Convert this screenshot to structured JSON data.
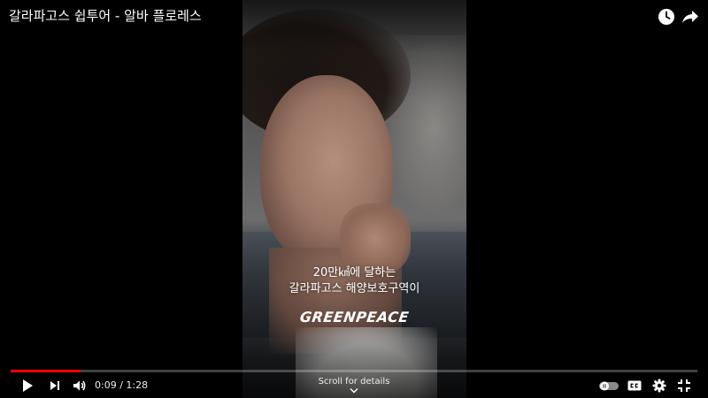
{
  "video": {
    "title": "갈라파고스 쉽투어 - 알바 플로레스",
    "caption_line1": "20만㎢에 달하는",
    "caption_line2": "갈라파고스 해양보호구역이",
    "logo_text": "GREENPEACE"
  },
  "top_actions": [
    {
      "name": "watch-later",
      "icon": "clock-icon"
    },
    {
      "name": "share",
      "icon": "share-arrow-icon"
    }
  ],
  "controls": {
    "current_time": "0:09",
    "duration": "1:28",
    "time_display": "0:09 / 1:28",
    "progress_fraction": 0.102,
    "scroll_hint": "Scroll for details",
    "play_icon": "play-icon",
    "next_icon": "next-icon",
    "volume_icon": "volume-icon",
    "autoplay_icon": "autoplay-toggle-icon",
    "cc_icon": "cc-icon",
    "settings_icon": "gear-icon",
    "fullscreen_icon": "exit-fullscreen-icon"
  },
  "colors": {
    "progress": "#ff0000",
    "background": "#000000"
  }
}
